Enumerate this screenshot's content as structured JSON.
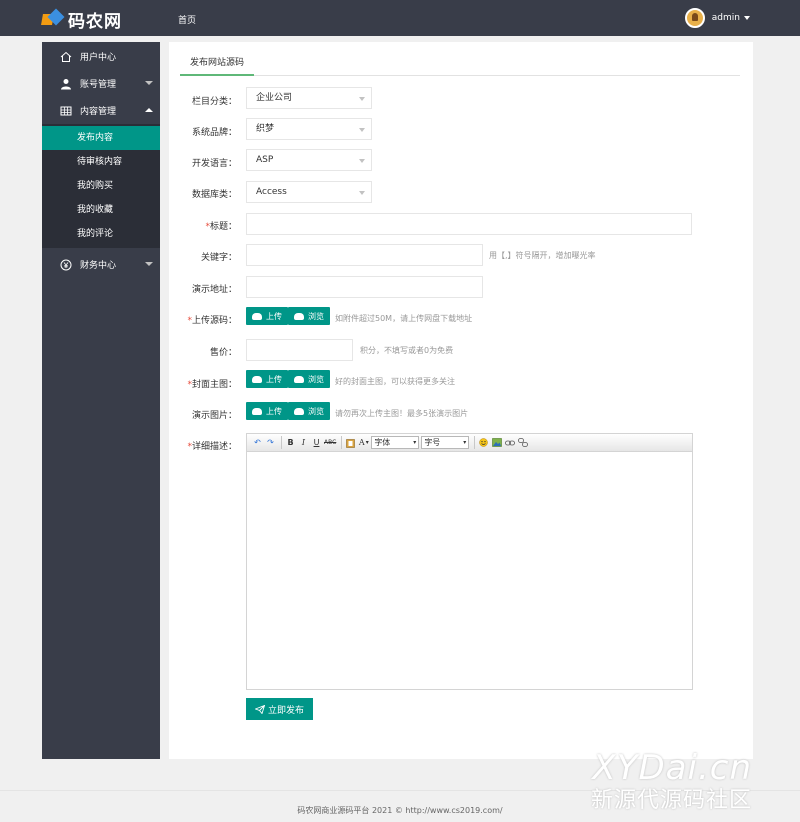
{
  "header": {
    "logo_text": "码农网",
    "nav_home": "首页",
    "user_name": "admin"
  },
  "sidebar": {
    "items": [
      {
        "label": "用户中心",
        "icon": "home-icon"
      },
      {
        "label": "账号管理",
        "icon": "user-icon"
      },
      {
        "label": "内容管理",
        "icon": "table-icon"
      },
      {
        "label": "财务中心",
        "icon": "yen-icon"
      }
    ],
    "submenu": [
      "发布内容",
      "待审核内容",
      "我的购买",
      "我的收藏",
      "我的评论"
    ]
  },
  "tab": {
    "label": "发布网站源码"
  },
  "form": {
    "category": {
      "label": "栏目分类：",
      "value": "企业公司"
    },
    "brand": {
      "label": "系统品牌：",
      "value": "织梦"
    },
    "language": {
      "label": "开发语言：",
      "value": "ASP"
    },
    "database": {
      "label": "数据库类：",
      "value": "Access"
    },
    "title": {
      "label": "标题：",
      "required": "*",
      "value": ""
    },
    "keywords": {
      "label": "关键字：",
      "value": "",
      "hint": "用【,】符号隔开，增加曝光率"
    },
    "demo_url": {
      "label": "演示地址：",
      "value": ""
    },
    "upload_source": {
      "label": "上传源码：",
      "required": "*",
      "upload": "上传",
      "browse": "浏览",
      "hint": "如附件超过50M，请上传网盘下载地址"
    },
    "price": {
      "label": "售价：",
      "value": "",
      "hint": "积分，不填写或者0为免费"
    },
    "cover": {
      "label": "封面主图：",
      "required": "*",
      "upload": "上传",
      "browse": "浏览",
      "hint": "好的封面主图，可以获得更多关注"
    },
    "demo_images": {
      "label": "演示图片：",
      "upload": "上传",
      "browse": "浏览",
      "hint": "请勿再次上传主图！最多5张演示图片"
    },
    "description": {
      "label": "详细描述：",
      "required": "*"
    }
  },
  "editor": {
    "bold": "B",
    "italic": "I",
    "underline": "U",
    "strike": "ABC",
    "font_color": "A",
    "font_family": "字体",
    "font_size": "字号"
  },
  "submit_label": "立即发布",
  "footer": {
    "text": "码农网商业源码平台 2021 © http://www.cs2019.com/"
  },
  "watermark": {
    "line1": "XYDai.cn",
    "line2": "新源代源码社区"
  }
}
